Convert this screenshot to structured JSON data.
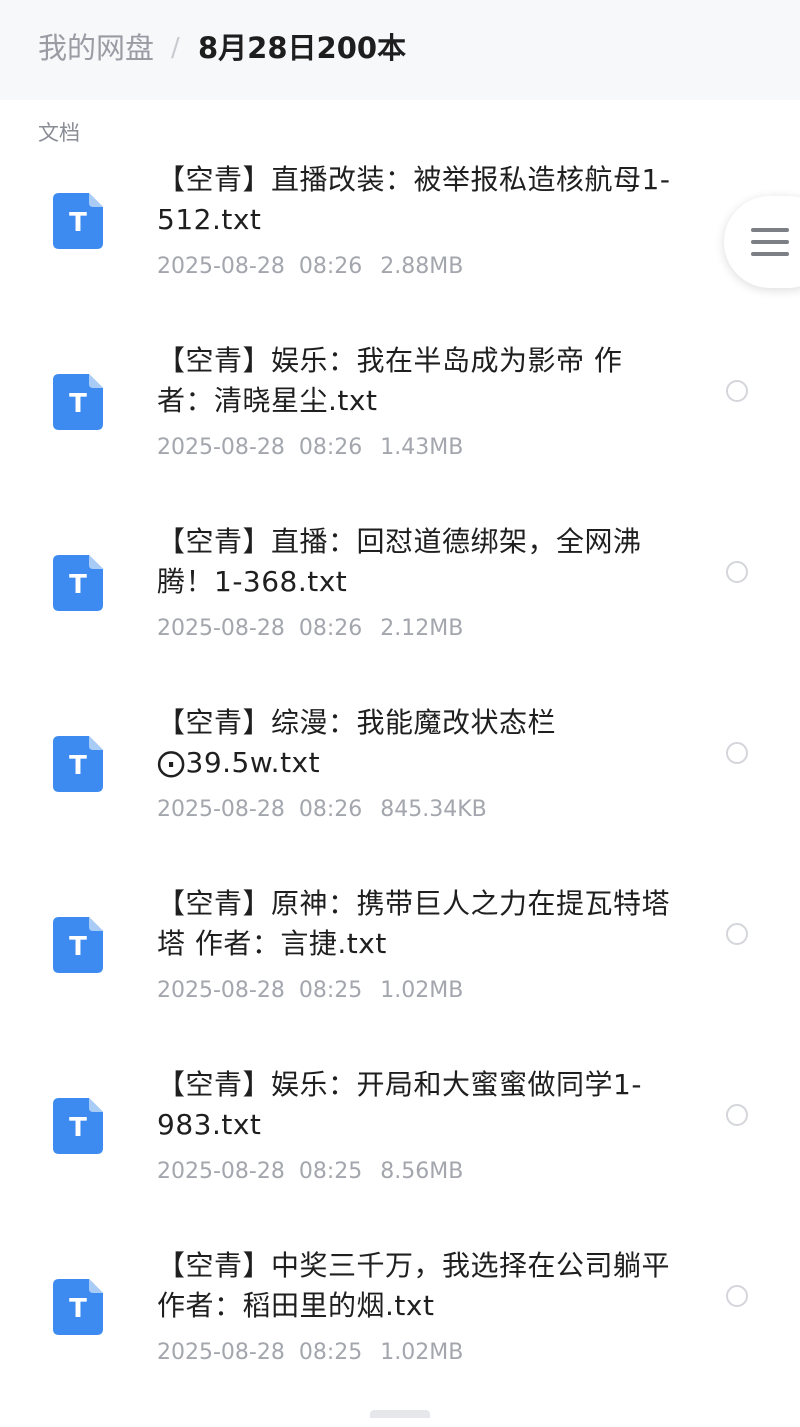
{
  "header": {
    "root": "我的网盘",
    "separator": "/",
    "current": "8月28日200本"
  },
  "section": {
    "label": "文档"
  },
  "file_icon": {
    "glyph": "T",
    "color": "#3d8bf0",
    "fold_color": "#a9ccf7",
    "icon": "txt-file-icon"
  },
  "files": [
    {
      "name": "【空青】直播改装：被举报私造核航母1-512.txt",
      "date": "2025-08-28",
      "time": "08:26",
      "size": "2.88MB"
    },
    {
      "name": "【空青】娱乐：我在半岛成为影帝 作者：清晓星尘.txt",
      "date": "2025-08-28",
      "time": "08:26",
      "size": "1.43MB"
    },
    {
      "name": "【空青】直播：回怼道德绑架，全网沸腾！1-368.txt",
      "date": "2025-08-28",
      "time": "08:26",
      "size": "2.12MB"
    },
    {
      "name": "【空青】综漫：我能魔改状态栏⨀39.5w.txt",
      "date": "2025-08-28",
      "time": "08:26",
      "size": "845.34KB"
    },
    {
      "name": "【空青】原神：携带巨人之力在提瓦特塔塔 作者：言捷.txt",
      "date": "2025-08-28",
      "time": "08:25",
      "size": "1.02MB"
    },
    {
      "name": "【空青】娱乐：开局和大蜜蜜做同学1-983.txt",
      "date": "2025-08-28",
      "time": "08:25",
      "size": "8.56MB"
    },
    {
      "name": "【空青】中奖三千万，我选择在公司躺平 作者：稻田里的烟.txt",
      "date": "2025-08-28",
      "time": "08:25",
      "size": "1.02MB"
    }
  ],
  "menu_button": {
    "icon": "hamburger-menu-icon"
  }
}
